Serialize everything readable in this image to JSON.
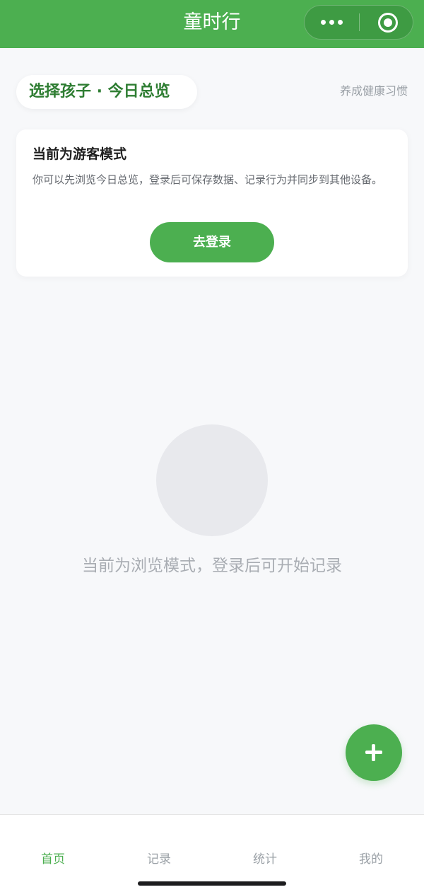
{
  "header": {
    "title": "童时行",
    "menu_icon": "more-dots-icon",
    "close_icon": "capsule-close-icon",
    "background_color": "#4caf50"
  },
  "top": {
    "child_selector": "选择孩子 · 今日总览",
    "slogan": "养成健康习惯"
  },
  "guest_card": {
    "title": "当前为游客模式",
    "description": "你可以先浏览今日总览，登录后可保存数据、记录行为并同步到其他设备。",
    "login_button": "去登录"
  },
  "empty_state": {
    "message": "当前为浏览模式，登录后可开始记录"
  },
  "fab": {
    "icon": "plus-icon"
  },
  "tabbar": {
    "tabs": [
      {
        "label": "首页",
        "active": true
      },
      {
        "label": "记录",
        "active": false
      },
      {
        "label": "统计",
        "active": false
      },
      {
        "label": "我的",
        "active": false
      }
    ]
  },
  "colors": {
    "accent": "#4caf50",
    "accent_dark_text": "#2e7d32",
    "muted_text": "#9aa0a6",
    "page_background": "#f7f8fa"
  }
}
